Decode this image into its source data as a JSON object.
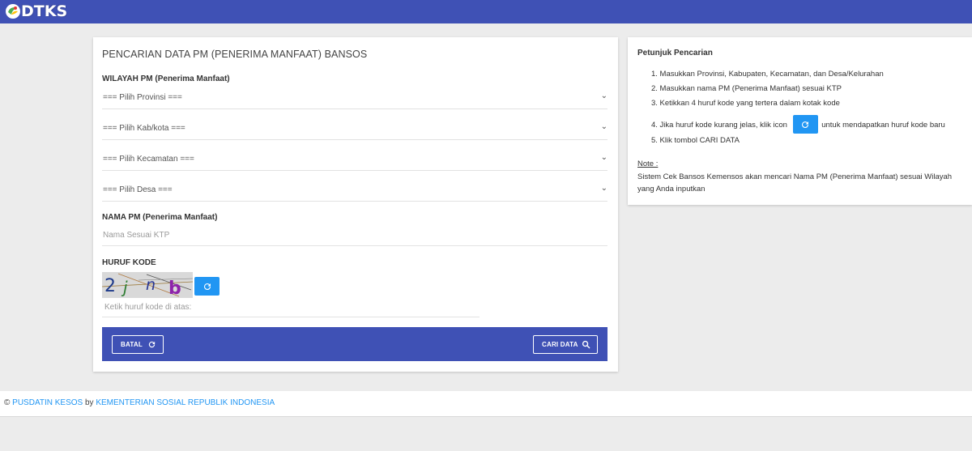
{
  "header": {
    "logo_text": "DTKS",
    "brand_color": "#3f51b5"
  },
  "form": {
    "title": "PENCARIAN DATA PM (PENERIMA MANFAAT) BANSOS",
    "wilayah_label": "WILAYAH PM (Penerima Manfaat)",
    "selects": {
      "provinsi": "=== Pilih Provinsi ===",
      "kabkota": "=== Pilih Kab/kota ===",
      "kecamatan": "=== Pilih Kecamatan ===",
      "desa": "=== Pilih Desa ==="
    },
    "nama_label": "NAMA PM (Penerima Manfaat)",
    "nama_placeholder": "Nama Sesuai KTP",
    "huruf_label": "HURUF KODE",
    "captcha_text": "2jnb",
    "captcha_placeholder": "Ketik huruf kode di atas:",
    "batal_label": "BATAL",
    "cari_label": "CARI DATA"
  },
  "help": {
    "title": "Petunjuk Pencarian",
    "steps": [
      "1. Masukkan Provinsi, Kabupaten, Kecamatan, dan Desa/Kelurahan",
      "2. Masukkan nama PM (Penerima Manfaat) sesuai KTP",
      "3. Ketikkan 4 huruf kode yang tertera dalam kotak kode",
      "4. Jika huruf kode kurang jelas, klik icon",
      "5. Klik tombol CARI DATA"
    ],
    "step4_suffix": "untuk mendapatkan huruf kode baru",
    "note_label": "Note :",
    "note_text": "Sistem Cek Bansos Kemensos akan mencari Nama PM (Penerima Manfaat) sesuai Wilayah yang Anda inputkan"
  },
  "footer": {
    "copyright": "©",
    "pusdatin": "PUSDATIN KESOS",
    "by": "by",
    "kementerian": "KEMENTERIAN SOSIAL REPUBLIK INDONESIA"
  },
  "icons": {
    "refresh": "refresh-icon",
    "search": "search-icon",
    "chevron": "chevron-down-icon"
  },
  "colors": {
    "accent": "#2196f3",
    "primary": "#3f51b5"
  }
}
